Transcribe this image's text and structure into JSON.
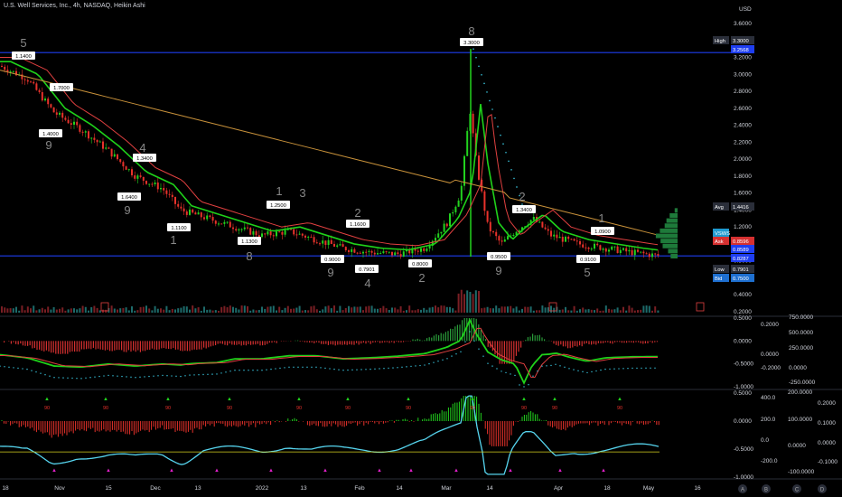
{
  "header": {
    "title": "U.S. Well Services, Inc., 4h, NASDAQ, Heikin Ashi"
  },
  "currency": "USD",
  "colors": {
    "bg": "#000000",
    "up": "#22d31e",
    "down": "#e8322b",
    "ema_green": "#1fd21a",
    "ema_red": "#e04040",
    "sma": "#c8913a",
    "blue_line": "#1e3ef0",
    "dots": "#39c7e0",
    "grid_text": "#d1d4dc",
    "label_bg": "#ffffff",
    "label_text": "#000000",
    "hist_green": "#2a9d3a",
    "hist_red": "#d53030",
    "cyan": "#56d4ee",
    "magenta": "#e020c8",
    "yellow": "#d8d220",
    "axis_tag_high": "#1a1a1a"
  },
  "chart_data": [
    {
      "type": "candlestick",
      "name": "price-pane",
      "ylim": [
        0.2,
        3.7
      ],
      "y_ticks": [
        "3.6000",
        "3.4000",
        "3.2000",
        "3.0000",
        "2.8000",
        "2.6000",
        "2.4000",
        "2.2000",
        "2.0000",
        "1.8000",
        "1.6000",
        "1.4000",
        "1.2000",
        "1.0000",
        "0.8000",
        "0.6000",
        "0.4000",
        "0.2000"
      ],
      "x_ticks": [
        "18",
        "Nov",
        "15",
        "Dec",
        "13",
        "2022",
        "13",
        "Feb",
        "14",
        "Mar",
        "14",
        "Apr",
        "18",
        "May",
        "16"
      ],
      "price_tags": [
        {
          "label": "High",
          "value": "3.3000",
          "kind": "high"
        },
        {
          "label": "",
          "value": "3.2568",
          "kind": "blue"
        },
        {
          "label": "Avg",
          "value": "1.4416",
          "kind": "avg"
        },
        {
          "label": "VSWS",
          "value": "",
          "kind": "sym"
        },
        {
          "label": "Ask",
          "value": "0.8596",
          "kind": "ask"
        },
        {
          "label": "",
          "value": "0.8589",
          "kind": "blue"
        },
        {
          "label": "",
          "value": "0.8287",
          "kind": "blue"
        },
        {
          "label": "Low",
          "value": "0.7901",
          "kind": "low"
        },
        {
          "label": "Bid",
          "value": "0.7500",
          "kind": "bid"
        }
      ],
      "horizontal_levels": [
        3.2568,
        0.8589
      ],
      "annotations": [
        "1.1400",
        "1.7000",
        "1.4000",
        "1.3400",
        "1.6400",
        "1.1100",
        "1.1300",
        "1.2500",
        "1.1600",
        "0.9000",
        "0.7901",
        "0.8000",
        "3.3000",
        "0.9500",
        "1.3400",
        "1.0900",
        "0.9100"
      ],
      "td_counts": [
        "5",
        "9",
        "4",
        "9",
        "1",
        "8",
        "1",
        "3",
        "2",
        "9",
        "4",
        "2",
        "8",
        "9",
        "2",
        "1",
        "5"
      ],
      "series_note_ma": [
        "ema-fast",
        "ema-slow",
        "sma-long"
      ]
    },
    {
      "type": "oscillator",
      "name": "macd-pane",
      "left_ticks": [
        "0.5000",
        "0.0000",
        "-0.5000",
        "-1.0000"
      ],
      "right_ticks_a": [
        "0.2000",
        "0.0000",
        "-0.2000"
      ],
      "right_ticks_b": [
        "750.0000",
        "500.0000",
        "250.0000",
        "0.0000",
        "-250.0000"
      ]
    },
    {
      "type": "oscillator",
      "name": "signals-pane",
      "left_ticks": [
        "0.5000",
        "0.0000",
        "-0.5000",
        "-1.0000"
      ],
      "right_ticks_a": [
        "400.0",
        "200.0",
        "0.0",
        "-200.0"
      ],
      "right_ticks_b": [
        "200.0000",
        "100.0000",
        "0.0000",
        "-100.0000"
      ],
      "right_ticks_c": [
        "0.2000",
        "0.1000",
        "0.0000",
        "-0.1000"
      ],
      "signal_label": "90"
    }
  ],
  "corner_labels": [
    "A",
    "B",
    "C",
    "D"
  ]
}
